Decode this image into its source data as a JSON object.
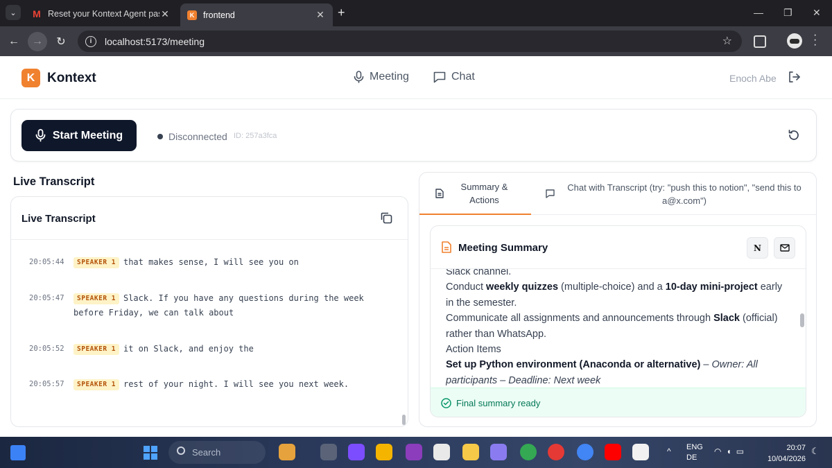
{
  "browser": {
    "tabs": [
      {
        "title": "Reset your Kontext Agent passw",
        "favicon": "gmail-icon"
      },
      {
        "title": "frontend",
        "favicon": "kontext-icon"
      }
    ],
    "url": "localhost:5173/meeting"
  },
  "header": {
    "logo_letter": "K",
    "brand": "Kontext",
    "nav": {
      "meeting": "Meeting",
      "chat": "Chat"
    },
    "user": "Enoch Abe"
  },
  "controls": {
    "start_label": "Start Meeting",
    "status": "Disconnected",
    "session_id": "ID: 257a3fca"
  },
  "transcript": {
    "section_title": "Live Transcript",
    "card_title": "Live Transcript",
    "segments": [
      {
        "time": "20:05:44",
        "speaker": "SPEAKER 1",
        "text": "that makes sense, I will see you on"
      },
      {
        "time": "20:05:47",
        "speaker": "SPEAKER 1",
        "text": "Slack. If you have any questions during the week before Friday, we can talk about"
      },
      {
        "time": "20:05:52",
        "speaker": "SPEAKER 1",
        "text": "it on Slack, and enjoy the"
      },
      {
        "time": "20:05:57",
        "speaker": "SPEAKER 1",
        "text": "rest of your night. I will see you next week."
      }
    ]
  },
  "panel": {
    "tabs": {
      "summary": "Summary & Actions",
      "chat": "Chat with Transcript (try: \"push this to notion\", \"send this to a@x.com\")"
    },
    "summary": {
      "title": "Meeting Summary",
      "notion_letter": "N",
      "line1": "Slack channel.",
      "line2_a": "Conduct ",
      "line2_b": "weekly quizzes",
      "line2_c": " (multiple-choice) and a ",
      "line2_d": "10-day mini-project",
      "line2_e": " early in the semester.",
      "line3_a": "Communicate all assignments and announcements through ",
      "line3_b": "Slack",
      "line3_c": " (official) rather than WhatsApp.",
      "action_heading": "Action Items",
      "action1_bold": "Set up Python environment (Anaconda or alternative)",
      "action1_sep": " – ",
      "action1_meta": "Owner: All participants – Deadline: Next week",
      "ready": "Final summary ready"
    }
  },
  "taskbar": {
    "search": "Search",
    "lang1": "ENG",
    "lang2": "DE",
    "time": "20:07",
    "date": "10/04/2026"
  }
}
